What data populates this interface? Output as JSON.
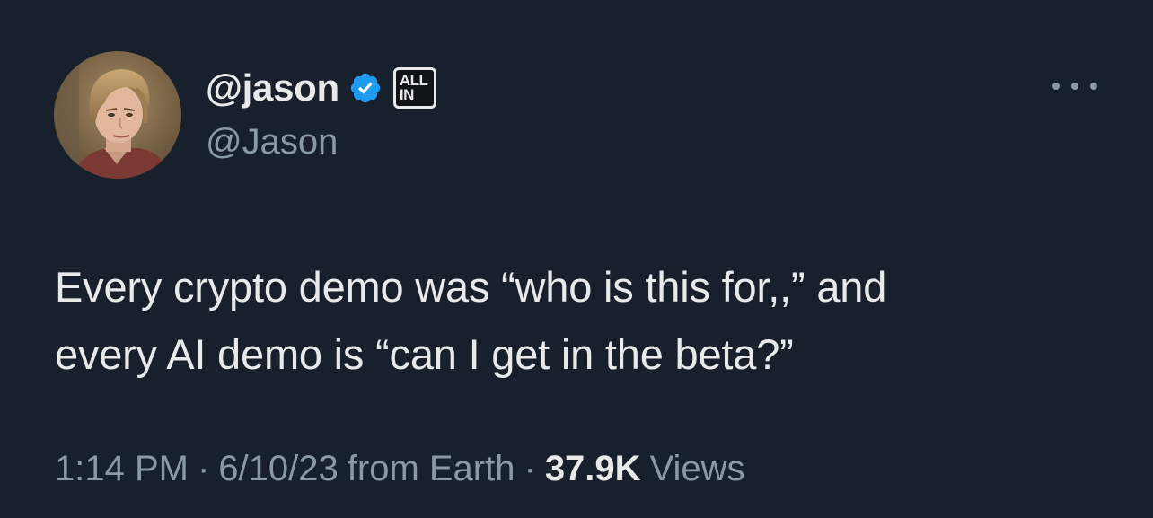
{
  "author": {
    "display_name": "@jason",
    "handle": "@Jason",
    "verified_color": "#1d9bf0",
    "affiliate_badge": {
      "line1": "ALL",
      "line2": "IN"
    }
  },
  "tweet": {
    "text_line1": "Every crypto demo was “who is this for,,” and",
    "text_line2": "every AI demo is “can I get in the beta?”"
  },
  "meta": {
    "time": "1:14 PM",
    "separator": "·",
    "date": "6/10/23",
    "source": "from Earth",
    "views_count": "37.9K",
    "views_label": "Views"
  },
  "icons": {
    "verified": "verified-badge-icon",
    "more": "more-options-icon"
  }
}
